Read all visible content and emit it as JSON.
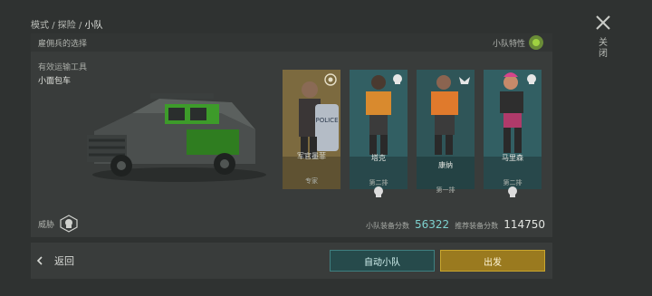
{
  "breadcrumb": {
    "items": [
      "模式",
      "探险"
    ],
    "separator": "/",
    "current": "小队"
  },
  "close": {
    "label": "关闭",
    "icon": "close-icon"
  },
  "squad_panel": {
    "title": "雇佣兵的选择",
    "trait_label": "小队特性",
    "trait_icon": "squad-trait-icon",
    "transport_label": "有效运输工具",
    "transport_value": "小面包车",
    "threat_label": "威胁",
    "threat_icon": "threat-skull-icon",
    "members": [
      {
        "name": "军官墨菲",
        "role": "专家",
        "accent": "#b08a3a"
      },
      {
        "name": "塔克",
        "role": "第二排",
        "accent": "#3f8e92"
      },
      {
        "name": "康纳",
        "role": "第一排",
        "accent": "#3f8e92"
      },
      {
        "name": "马里森",
        "role": "第二排",
        "accent": "#3f8e92"
      }
    ],
    "score_label": "小队装备分数",
    "score_value": "56322",
    "recommended_label": "推荐装备分数",
    "recommended_value": "114750"
  },
  "bottom_bar": {
    "back_label": "返回",
    "auto_squad_label": "自动小队",
    "depart_label": "出发"
  },
  "colors": {
    "accent_teal": "#7ed2cf",
    "depart_gold": "#c9a62d",
    "trait_green": "#9fd241"
  }
}
